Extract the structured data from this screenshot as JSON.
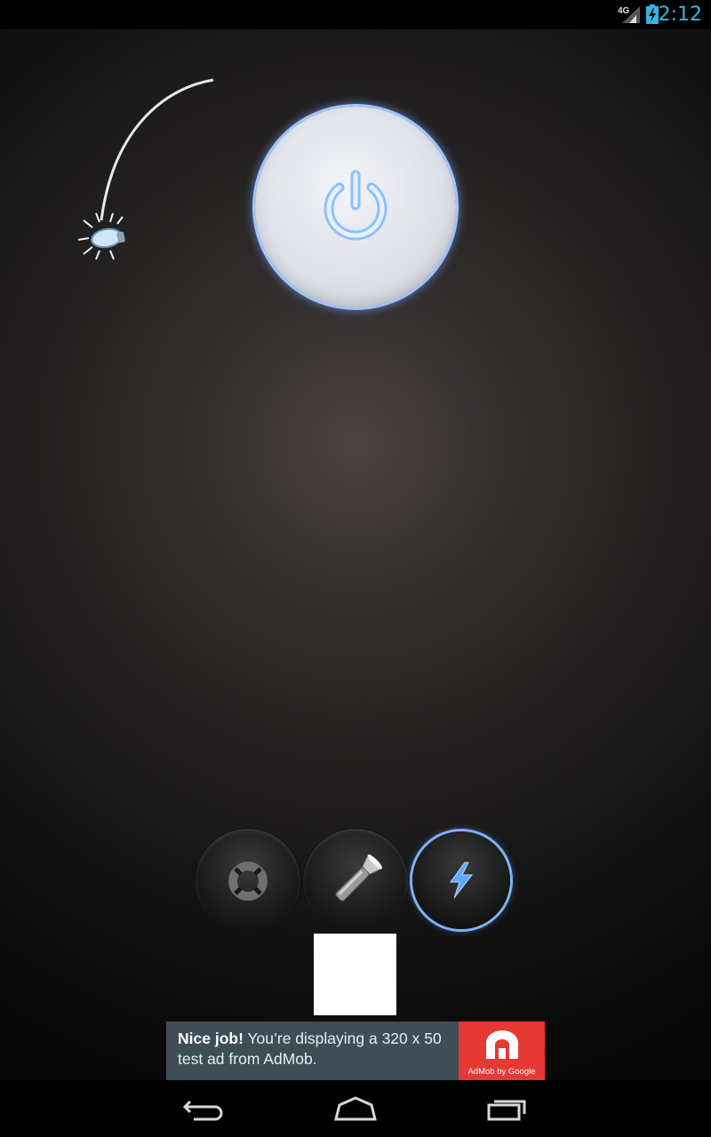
{
  "status_bar": {
    "time": "2:12",
    "network": "4G",
    "icons": [
      "signal-icon",
      "battery-charging-icon"
    ],
    "accent_color": "#33b5e5"
  },
  "main": {
    "power_button": {
      "icon": "power-icon"
    },
    "pendulum": {
      "icon": "light-bulb-icon"
    },
    "modes": [
      {
        "name": "sos",
        "icon": "lifebuoy-icon",
        "selected": false
      },
      {
        "name": "torch",
        "icon": "flashlight-icon",
        "selected": false
      },
      {
        "name": "flash",
        "icon": "lightning-bolt-icon",
        "selected": true
      }
    ]
  },
  "ad": {
    "headline": "Nice job!",
    "body": " You’re displaying a 320 x 50 test ad from AdMob.",
    "logo_caption": "AdMob by Google",
    "background_color": "#3e4d56",
    "logo_color": "#e53935"
  },
  "nav_bar": {
    "icons": [
      "back-icon",
      "home-icon",
      "recent-apps-icon"
    ]
  }
}
